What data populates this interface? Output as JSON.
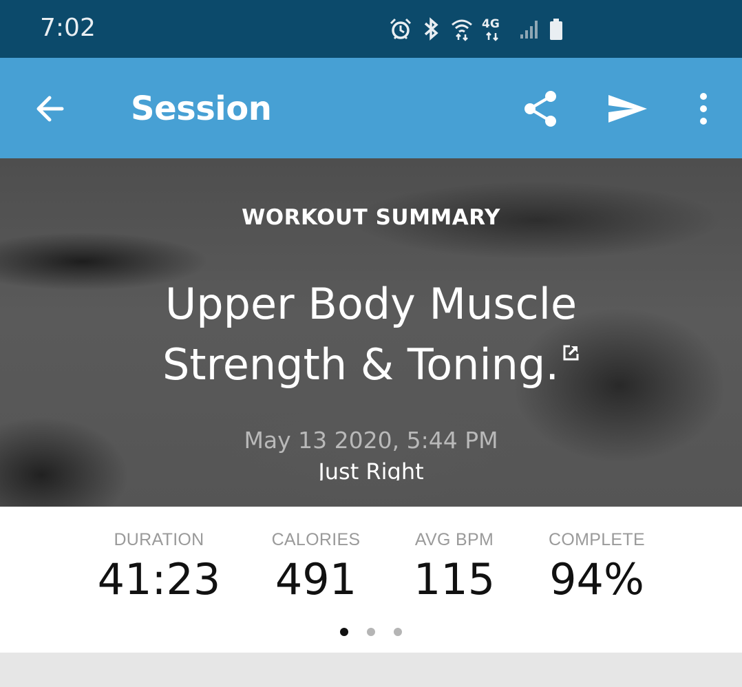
{
  "status_bar": {
    "time": "7:02",
    "network": "4G",
    "icons": [
      "alarm-icon",
      "bluetooth-icon",
      "wifi-icon",
      "network-4g-icon",
      "signal-icon",
      "battery-icon"
    ]
  },
  "app_bar": {
    "title": "Session",
    "color": "#47a0d4",
    "actions": [
      "share-icon",
      "send-icon",
      "more-vert-icon"
    ]
  },
  "summary": {
    "label": "WORKOUT SUMMARY",
    "title_line1": "Upper Body Muscle",
    "title_line2": "Strength & Toning.",
    "date": "May 13 2020, 5:44 PM",
    "rating": "Just Right"
  },
  "stats": [
    {
      "label": "DURATION",
      "value": "41:23"
    },
    {
      "label": "CALORIES",
      "value": "491"
    },
    {
      "label": "AVG BPM",
      "value": "115"
    },
    {
      "label": "COMPLETE",
      "value": "94%"
    }
  ],
  "pager": {
    "count": 3,
    "active_index": 0
  }
}
